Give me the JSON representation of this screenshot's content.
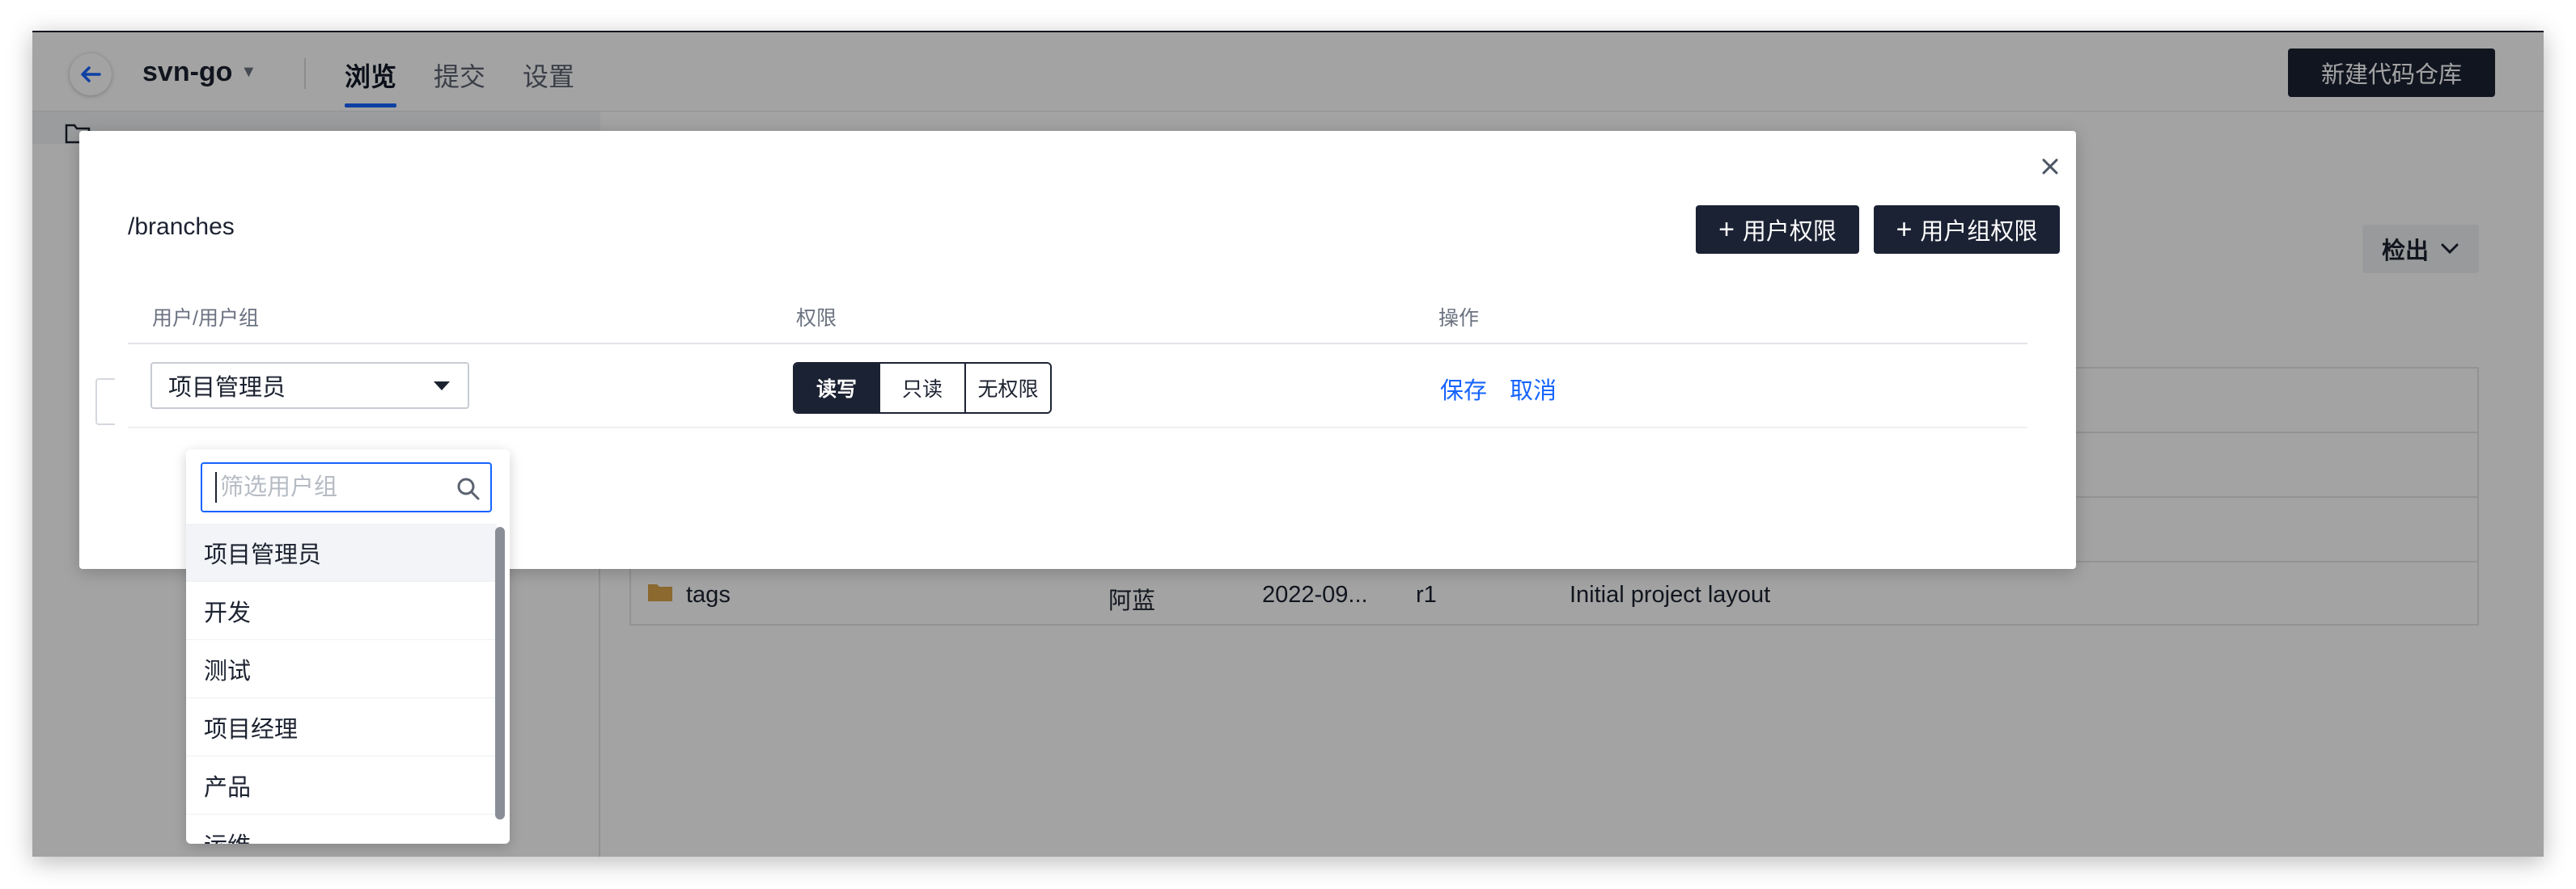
{
  "header": {
    "repo_name": "svn-go",
    "tabs": [
      {
        "label": "浏览",
        "active": true
      },
      {
        "label": "提交",
        "active": false
      },
      {
        "label": "设置",
        "active": false
      }
    ],
    "new_repo_button": "新建代码仓库"
  },
  "content": {
    "checkout_button": "检出",
    "file_rows": [
      {
        "name": "tags",
        "author": "阿蓝",
        "date": "2022-09...",
        "revision": "r1",
        "message": "Initial project layout"
      }
    ]
  },
  "modal": {
    "path": "/branches",
    "add_user_perm_button": "用户权限",
    "add_group_perm_button": "用户组权限",
    "columns": {
      "user": "用户/用户组",
      "permission": "权限",
      "action": "操作"
    },
    "row": {
      "selected_group": "项目管理员",
      "permissions": [
        {
          "label": "读写",
          "active": true
        },
        {
          "label": "只读",
          "active": false
        },
        {
          "label": "无权限",
          "active": false
        }
      ],
      "save": "保存",
      "cancel": "取消"
    }
  },
  "dropdown": {
    "filter_placeholder": "筛选用户组",
    "options": [
      "项目管理员",
      "开发",
      "测试",
      "项目经理",
      "产品",
      "运维"
    ],
    "hovered": "项目管理员"
  },
  "colors": {
    "primary_dark": "#1b2233",
    "link_blue": "#1664ff"
  }
}
